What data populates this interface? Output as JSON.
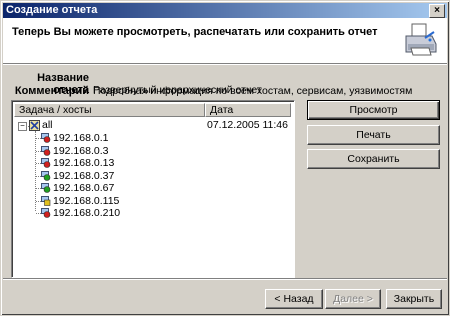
{
  "window": {
    "title": "Создание отчета",
    "close_glyph": "×"
  },
  "header": {
    "heading": "Теперь Вы можете просмотреть, распечатать или сохранить отчет"
  },
  "report": {
    "name_label": "Название отчета",
    "name_value": "Развернутый иерархический отчет",
    "comment_label": "Комментарий",
    "comment_value": "Подробная информация по всем хостам, сервисам, уязвимостям"
  },
  "table": {
    "columns": [
      "Задача / хосты",
      "Дата"
    ],
    "root": {
      "label": "all",
      "date": "07.12.2005 11:46",
      "expander": "−"
    },
    "hosts": [
      {
        "ip": "192.168.0.1",
        "status": "red"
      },
      {
        "ip": "192.168.0.3",
        "status": "red"
      },
      {
        "ip": "192.168.0.13",
        "status": "red"
      },
      {
        "ip": "192.168.0.37",
        "status": "green"
      },
      {
        "ip": "192.168.0.67",
        "status": "green"
      },
      {
        "ip": "192.168.0.115",
        "status": "yellow"
      },
      {
        "ip": "192.168.0.210",
        "status": "red"
      }
    ]
  },
  "actions": {
    "preview": "Просмотр",
    "print": "Печать",
    "save": "Сохранить"
  },
  "footer": {
    "back": "< Назад",
    "next": "Далее >",
    "close": "Закрыть"
  },
  "colors": {
    "red": "#d02020",
    "green": "#20a020",
    "yellow": "#e0c020",
    "title_start": "#0a246a",
    "title_end": "#a6caf0"
  }
}
